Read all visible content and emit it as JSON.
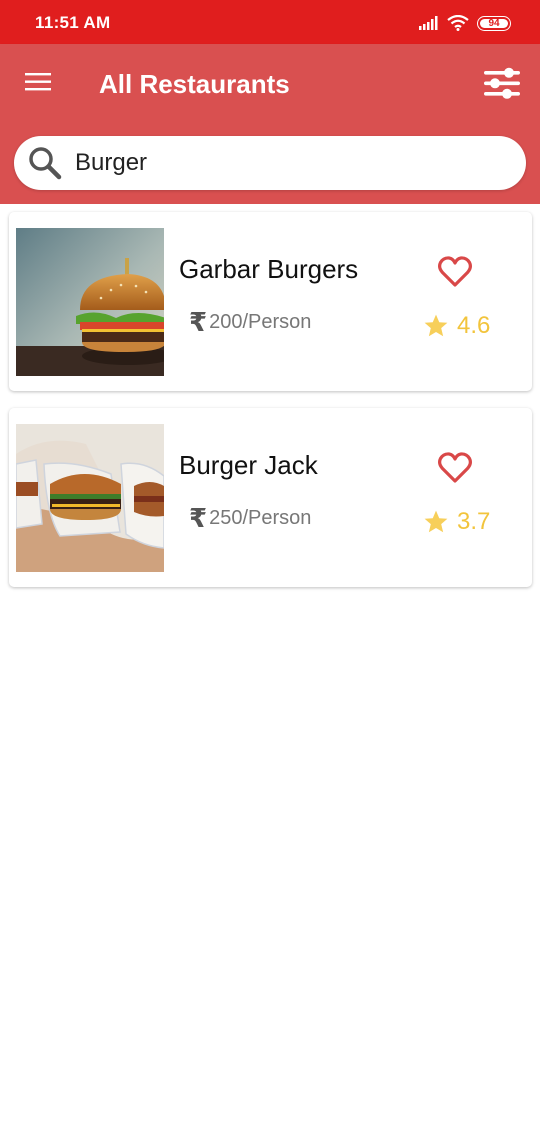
{
  "status_bar": {
    "time": "11:51 AM",
    "battery": "94"
  },
  "app_bar": {
    "title": "All Restaurants"
  },
  "search": {
    "value": "Burger"
  },
  "restaurants": [
    {
      "name": "Garbar Burgers",
      "currency": "₹",
      "price": "200/Person",
      "rating": "4.6"
    },
    {
      "name": "Burger Jack",
      "currency": "₹",
      "price": "250/Person",
      "rating": "3.7"
    }
  ],
  "colors": {
    "status_bar": "#e01e1e",
    "app_bar": "#d95050",
    "heart": "#d94848",
    "star": "#f2c43c"
  },
  "icons": [
    "signal-icon",
    "wifi-icon",
    "battery-icon",
    "menu-icon",
    "filter-icon",
    "search-icon",
    "heart-icon",
    "star-icon",
    "rupee-icon"
  ]
}
